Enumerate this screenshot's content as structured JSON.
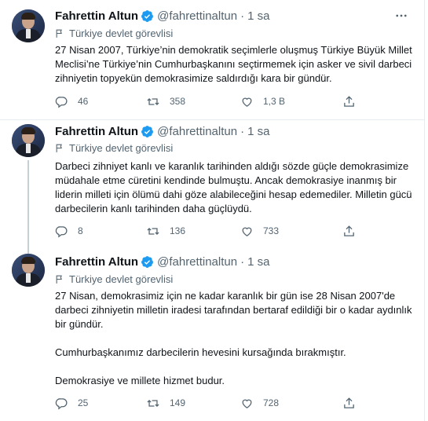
{
  "author": {
    "name": "Fahrettin Altun",
    "handle": "@fahrettinaltun",
    "label": "Türkiye devlet görevlisi"
  },
  "colors": {
    "verified": "#1d9bf0",
    "muted": "#536471",
    "text": "#0f1419",
    "thread_line": "#c4cfd6"
  },
  "icons": {
    "verified": "verified-badge-icon",
    "more": "more-icon",
    "flag": "flag-icon",
    "reply": "reply-icon",
    "retweet": "retweet-icon",
    "like": "like-icon",
    "share": "share-icon"
  },
  "tweets": [
    {
      "time": "1 sa",
      "paragraphs": [
        "27 Nisan 2007, Türkiye’nin demokratik seçimlerle oluşmuş Türkiye Büyük Millet Meclisi’ne Türkiye’nin Cumhurbaşkanını seçtirmemek için asker ve sivil darbeci zihniyetin topyekün demokrasimize saldırdığı kara bir gündür."
      ],
      "replies": "46",
      "retweets": "358",
      "likes": "1,3 B"
    },
    {
      "time": "1 sa",
      "paragraphs": [
        "Darbeci zihniyet kanlı ve karanlık tarihinden aldığı sözde güçle demokrasimize müdahale etme cüretini kendinde bulmuştu. Ancak demokrasiye inanmış bir liderin milleti için ölümü dahi göze alabileceğini hesap edemediler. Milletin gücü darbecilerin kanlı tarihinden daha güçlüydü."
      ],
      "replies": "8",
      "retweets": "136",
      "likes": "733"
    },
    {
      "time": "1 sa",
      "paragraphs": [
        "27 Nisan, demokrasimiz için ne kadar karanlık bir gün ise 28 Nisan 2007'de darbeci zihniyetin milletin iradesi tarafından bertaraf edildiği bir o kadar aydınlık bir gündür.",
        "Cumhurbaşkanımız darbecilerin hevesini kursağında bırakmıştır.",
        "Demokrasiye ve millete hizmet budur."
      ],
      "replies": "25",
      "retweets": "149",
      "likes": "728"
    }
  ]
}
